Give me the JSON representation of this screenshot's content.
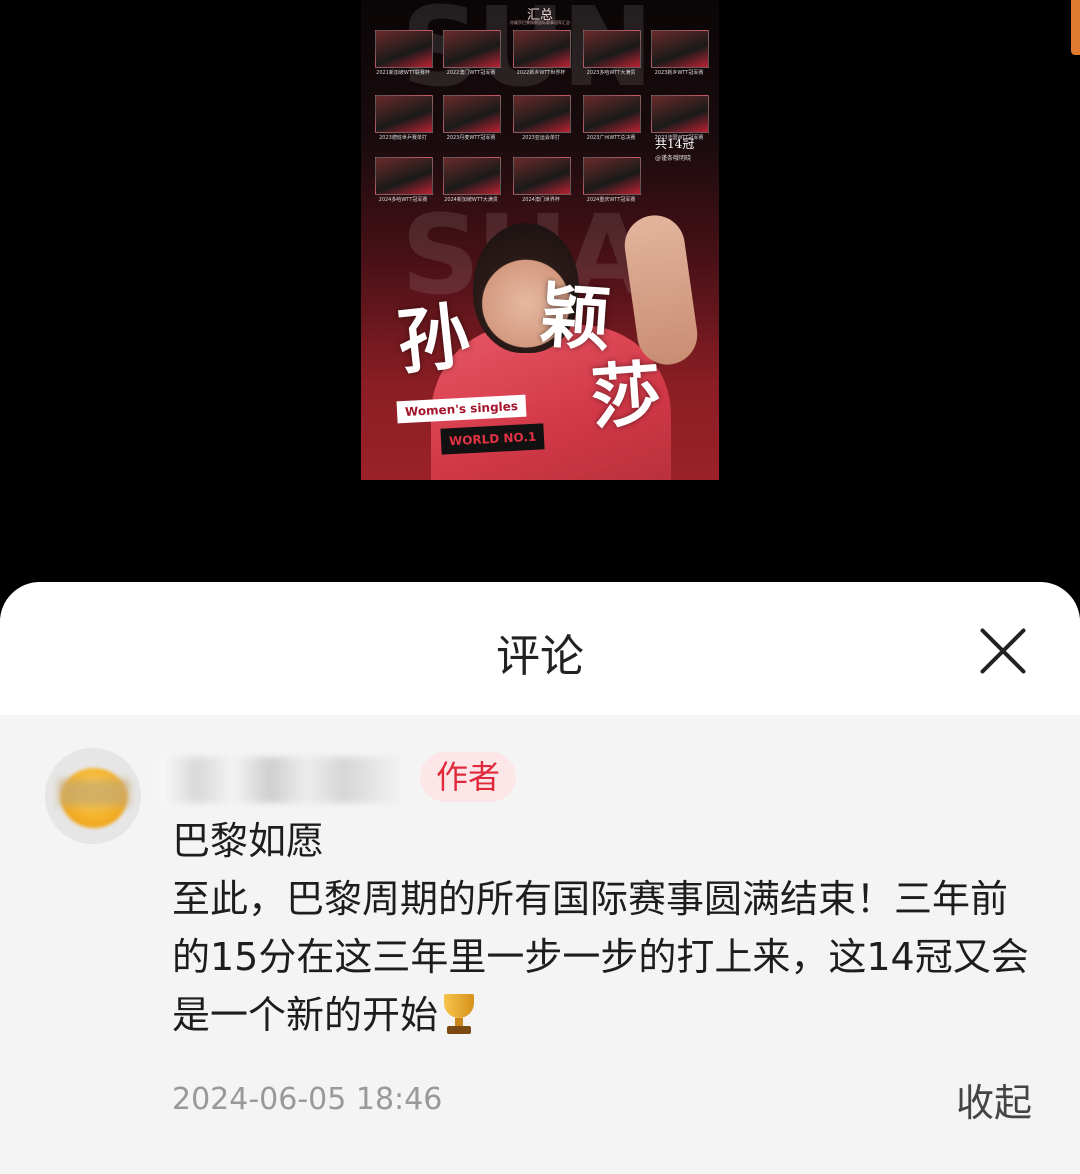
{
  "poster": {
    "subtitle": "汇总",
    "caption": "孙颖莎巴黎周期国际赛事冠军汇总",
    "bg_words": [
      "SUN",
      "SHA"
    ],
    "thumbs": [
      {
        "caption": "2021新加坡WTT联赛杯"
      },
      {
        "caption": "2022澳门WTT冠军赛"
      },
      {
        "caption": "2022新乡WTT世界杯"
      },
      {
        "caption": "2023多哈WTT大满贯"
      },
      {
        "caption": "2023新乡WTT冠军赛"
      },
      {
        "caption": "2023德班世乒赛单打"
      },
      {
        "caption": "2023丹麦WTT冠军赛"
      },
      {
        "caption": "2023亚运会单打"
      },
      {
        "caption": "2023广州WTT总决赛"
      },
      {
        "caption": "2023法国WTT冠军赛"
      },
      {
        "caption": "2024多哈WTT冠军赛"
      },
      {
        "caption": "2024新加坡WTT大满贯"
      },
      {
        "caption": "2024澳门世界杯"
      },
      {
        "caption": "2024重庆WTT冠军赛"
      }
    ],
    "total_label": "共14冠",
    "total_sub": "@谨条哦明晓",
    "calligraphy": [
      "孙",
      "颖",
      "莎"
    ],
    "tag_singles": "Women's singles",
    "tag_rank": "WORLD NO.1"
  },
  "sheet": {
    "title": "评论",
    "close_icon": "close-icon"
  },
  "comment": {
    "author_badge": "作者",
    "text": "巴黎如愿\n至此，巴黎周期的所有国际赛事圆满结束！三年前的15分在这三年里一步一步的打上来，这14冠又会是一个新的开始",
    "emoji": "trophy-icon",
    "timestamp": "2024-06-05 18:46",
    "collapse_label": "收起"
  },
  "colors": {
    "accent": "#e02a3c",
    "badge_bg": "#fde6e8",
    "sheet_bg": "#f4f4f4",
    "timestamp": "#999999"
  }
}
